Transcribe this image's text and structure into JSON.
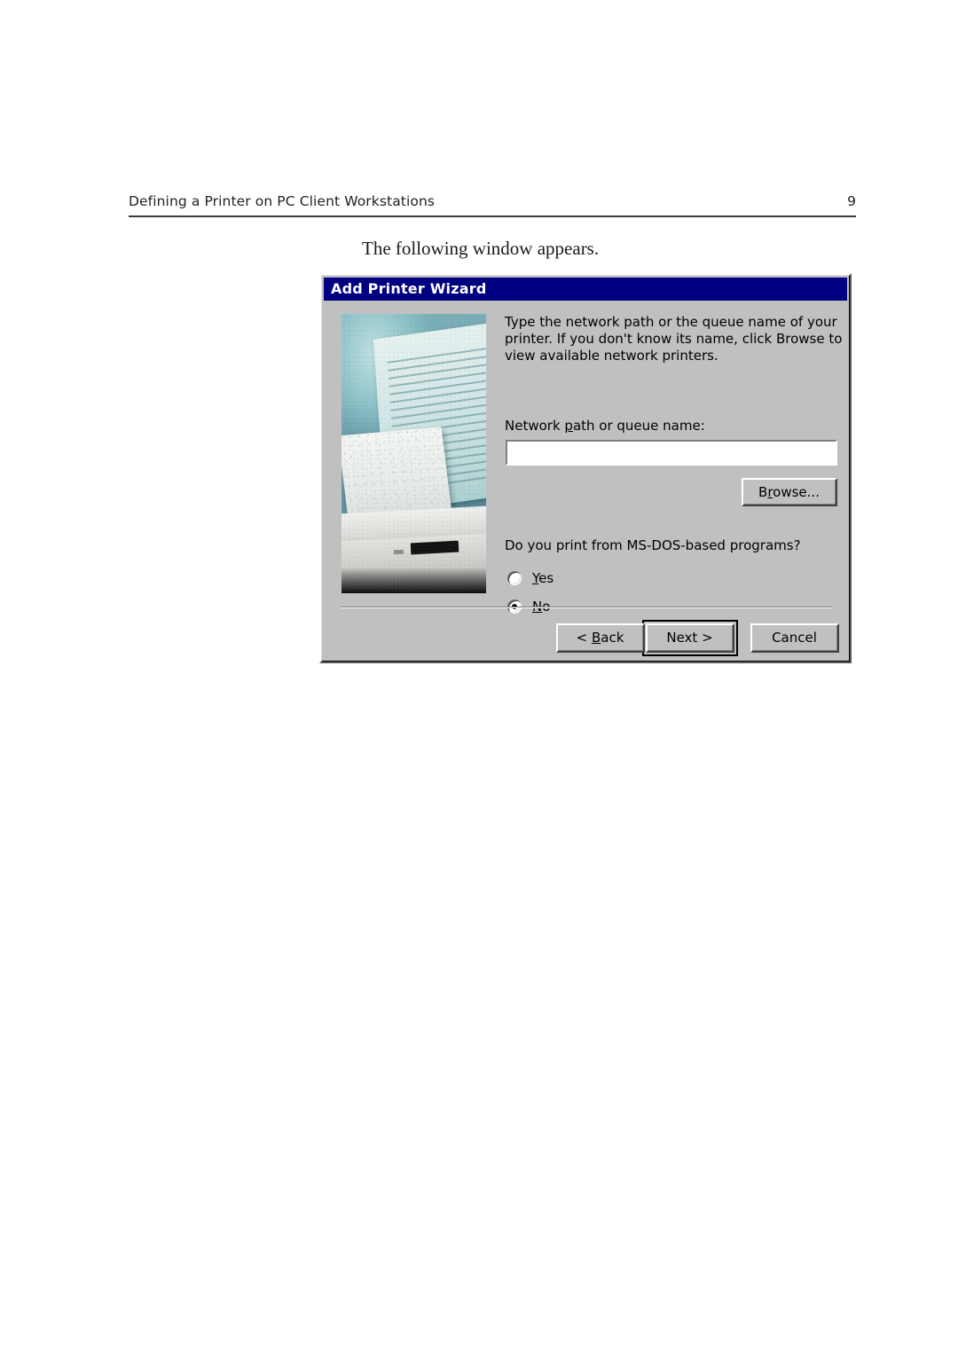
{
  "document": {
    "header_title": "Defining a Printer on PC Client Workstations",
    "page_number": "9",
    "body_text": "The following window appears."
  },
  "dialog": {
    "title": "Add Printer Wizard",
    "instruction": "Type the network path or the queue name of your printer. If you don't know its name, click Browse to view available network printers.",
    "field_label_pre": "Network ",
    "field_label_accel": "p",
    "field_label_post": "ath or queue name:",
    "path_input_value": "",
    "path_input_placeholder": "",
    "browse_button_pre": "B",
    "browse_button_accel": "r",
    "browse_button_post": "owse...",
    "question": "Do you print from MS-DOS-based programs?",
    "radios": [
      {
        "accel": "Y",
        "rest": "es",
        "selected": false
      },
      {
        "accel": "N",
        "rest": "o",
        "selected": true
      }
    ],
    "buttons": {
      "back_pre": "< ",
      "back_accel": "B",
      "back_post": "ack",
      "next": "Next >",
      "cancel": "Cancel"
    },
    "colors": {
      "titlebar": "#000080",
      "face": "#c0c0c0",
      "title_text": "#ffffff",
      "text": "#000000",
      "input_bg": "#ffffff"
    },
    "wizard_image_alt": "inkjet printer with printed page and typed letter in background"
  }
}
